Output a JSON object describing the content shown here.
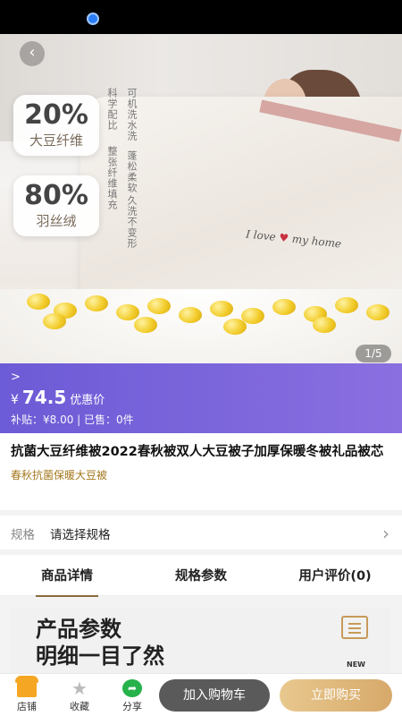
{
  "hero": {
    "badge1": {
      "percent": "20%",
      "label": "大豆纤维"
    },
    "badge2": {
      "percent": "80%",
      "label": "羽丝绒"
    },
    "vertical_text": [
      "可机洗水洗",
      "蓬松柔软",
      "久洗不变形",
      "科学配比",
      "整张纤维填充"
    ],
    "brand_text": "I love",
    "brand_text2": "my home",
    "image_counter": "1/5"
  },
  "price": {
    "arrow": ">",
    "currency": "¥",
    "value": "74.5",
    "label": "优惠价",
    "subsidy": "补贴：¥8.00  |  已售：0件"
  },
  "product": {
    "title": "抗菌大豆纤维被2022春秋被双人大豆被子加厚保暖冬被礼品被芯",
    "subtitle": "春秋抗菌保暖大豆被"
  },
  "spec": {
    "key": "规格",
    "value": "请选择规格"
  },
  "tabs": [
    "商品详情",
    "规格参数",
    "用户评价(0)"
  ],
  "detail": {
    "heading_line1": "产品参数",
    "heading_line2": "明细一目了然",
    "new_label": "NEW"
  },
  "bottom": {
    "store": "店铺",
    "favorite": "收藏",
    "share": "分享",
    "add_to_cart": "加入购物车",
    "buy_now": "立即购买"
  },
  "colors": {
    "price_bar": "#7a63dc",
    "buy_button": "#dfb57a",
    "cart_button": "#5a5a5a"
  }
}
